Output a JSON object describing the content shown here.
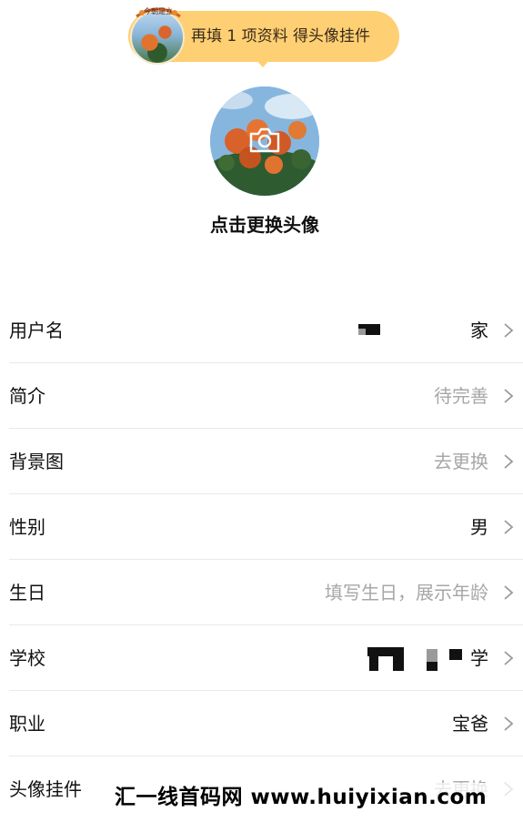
{
  "banner": {
    "frame_text": "今朝是立",
    "text": "再填 1 项资料 得头像挂件"
  },
  "avatar": {
    "change_label": "点击更换头像",
    "camera_icon": "camera-icon"
  },
  "rows": [
    {
      "label": "用户名",
      "value": "家",
      "muted": false
    },
    {
      "label": "简介",
      "value": "待完善",
      "muted": true
    },
    {
      "label": "背景图",
      "value": "去更换",
      "muted": true
    },
    {
      "label": "性别",
      "value": "男",
      "muted": false
    },
    {
      "label": "生日",
      "value": "填写生日，展示年龄",
      "muted": true
    },
    {
      "label": "学校",
      "value": "学",
      "muted": false
    },
    {
      "label": "职业",
      "value": "宝爸",
      "muted": false
    },
    {
      "label": "头像挂件",
      "value": "去更换",
      "muted": true
    }
  ],
  "watermark": "汇一线首码网 www.huiyixian.com",
  "colors": {
    "banner_bg": "#ffcf73",
    "muted_text": "#a7a7a7",
    "divider": "#e9e9e9"
  }
}
